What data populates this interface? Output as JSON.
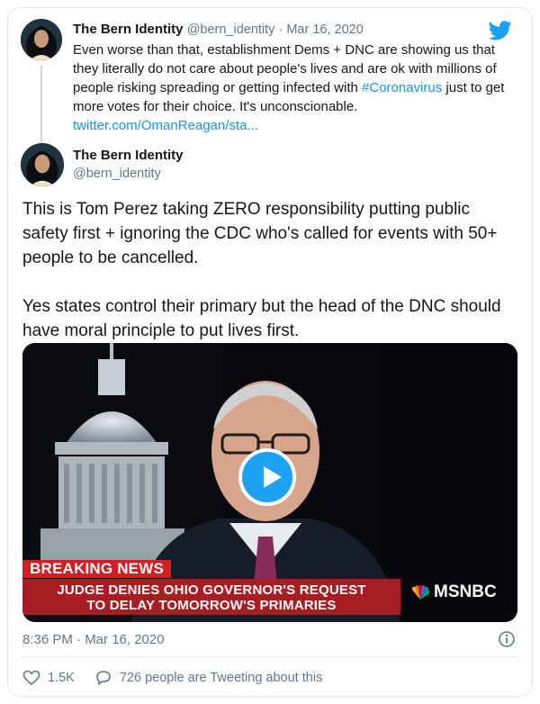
{
  "parent_tweet": {
    "name": "The Bern Identity",
    "handle_date": "@bern_identity · Mar 16, 2020",
    "text_before": "Even worse than that, establishment Dems + DNC are showing us that they literally do not care about people's lives and are ok with millions of people risking spreading or getting infected with ",
    "hashtag": "#Coronavirus",
    "text_after": " just to get more votes for their choice. It's unconscionable. ",
    "link": "twitter.com/OmanReagan/sta..."
  },
  "tweet": {
    "name": "The Bern Identity",
    "handle": "@bern_identity",
    "paragraph_1": "This is Tom Perez taking ZERO responsibility putting public safety first + ignoring the CDC who's called for events with 50+ people to be cancelled.",
    "paragraph_2": "Yes states control their primary but the head of the DNC should have moral principle to put lives first.",
    "timestamp": "8:36 PM · Mar 16, 2020"
  },
  "video": {
    "chyron_top": "BREAKING NEWS",
    "chyron_line_1": "JUDGE DENIES OHIO GOVERNOR'S REQUEST",
    "chyron_line_2": "TO DELAY TOMORROW'S PRIMARIES",
    "network": "MSNBC"
  },
  "actions": {
    "likes": "1.5K",
    "tweeting_about": "726 people are Tweeting about this"
  },
  "colors": {
    "twitter_blue": "#1da1f2",
    "link_blue": "#1b95e0",
    "secondary_text": "#657786",
    "chyron_red": "#d11f23"
  },
  "icons": [
    "twitter-bird-icon",
    "play-icon",
    "info-icon",
    "heart-icon",
    "speech-bubble-icon",
    "peacock-icon"
  ]
}
